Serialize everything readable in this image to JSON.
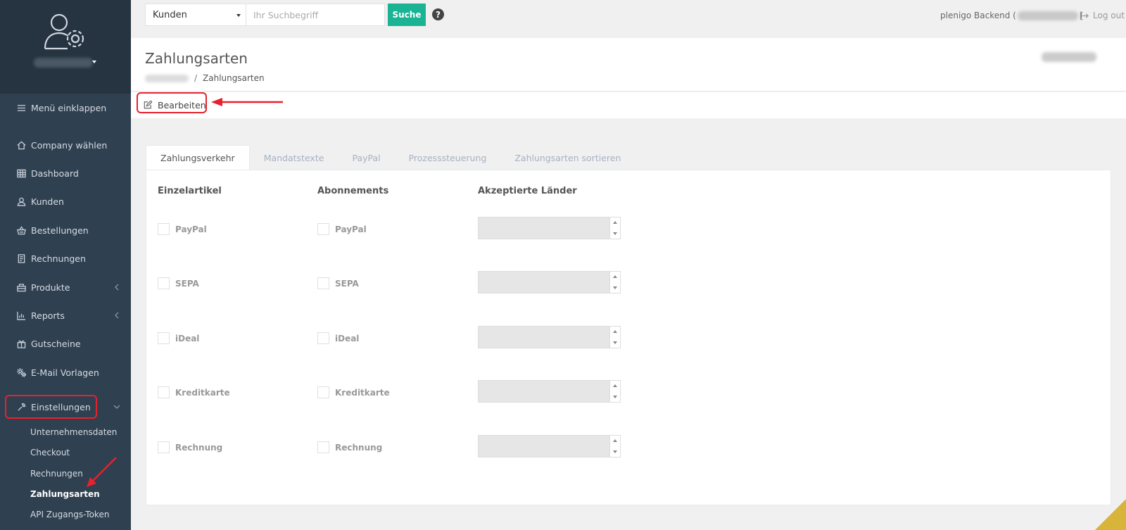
{
  "sidebar": {
    "items": [
      {
        "label": "Menü einklappen",
        "icon": "menu-icon"
      },
      {
        "label": "Company wählen",
        "icon": "home-icon"
      },
      {
        "label": "Dashboard",
        "icon": "grid-icon"
      },
      {
        "label": "Kunden",
        "icon": "user-icon"
      },
      {
        "label": "Bestellungen",
        "icon": "basket-icon"
      },
      {
        "label": "Rechnungen",
        "icon": "receipt-icon"
      },
      {
        "label": "Produkte",
        "icon": "box-icon"
      },
      {
        "label": "Reports",
        "icon": "chart-icon"
      },
      {
        "label": "Gutscheine",
        "icon": "gift-icon"
      },
      {
        "label": "E-Mail Vorlagen",
        "icon": "gears-icon"
      },
      {
        "label": "Einstellungen",
        "icon": "wrench-icon"
      }
    ],
    "subitems": [
      {
        "label": "Unternehmensdaten"
      },
      {
        "label": "Checkout"
      },
      {
        "label": "Rechnungen"
      },
      {
        "label": "Zahlungsarten"
      },
      {
        "label": "API Zugangs-Token"
      }
    ]
  },
  "topbar": {
    "search_scope": "Kunden",
    "search_placeholder": "Ihr Suchbegriff",
    "search_button": "Suche",
    "help": "?",
    "backend_label_prefix": "plenigo Backend (",
    "backend_label_suffix": ")",
    "logout": "Log out"
  },
  "header": {
    "title": "Zahlungsarten",
    "breadcrumb_sep": "/",
    "breadcrumb_current": "Zahlungsarten"
  },
  "toolbar": {
    "edit_label": "Bearbeiten"
  },
  "tabs": [
    {
      "label": "Zahlungsverkehr",
      "active": true
    },
    {
      "label": "Mandatstexte"
    },
    {
      "label": "PayPal"
    },
    {
      "label": "Prozesssteuerung"
    },
    {
      "label": "Zahlungsarten sortieren"
    }
  ],
  "payment_form": {
    "col_single": "Einzelartikel",
    "col_subscription": "Abonnements",
    "col_countries": "Akzeptierte Länder",
    "methods": [
      {
        "label": "PayPal",
        "single_checked": false,
        "subscription_checked": false
      },
      {
        "label": "SEPA",
        "single_checked": false,
        "subscription_checked": false
      },
      {
        "label": "iDeal",
        "single_checked": false,
        "subscription_checked": false
      },
      {
        "label": "Kreditkarte",
        "single_checked": false,
        "subscription_checked": false
      },
      {
        "label": "Rechnung",
        "single_checked": false,
        "subscription_checked": false
      }
    ]
  },
  "colors": {
    "sidebar_bg": "#2f4050",
    "accent": "#1ab394",
    "highlight": "#e8212d"
  }
}
